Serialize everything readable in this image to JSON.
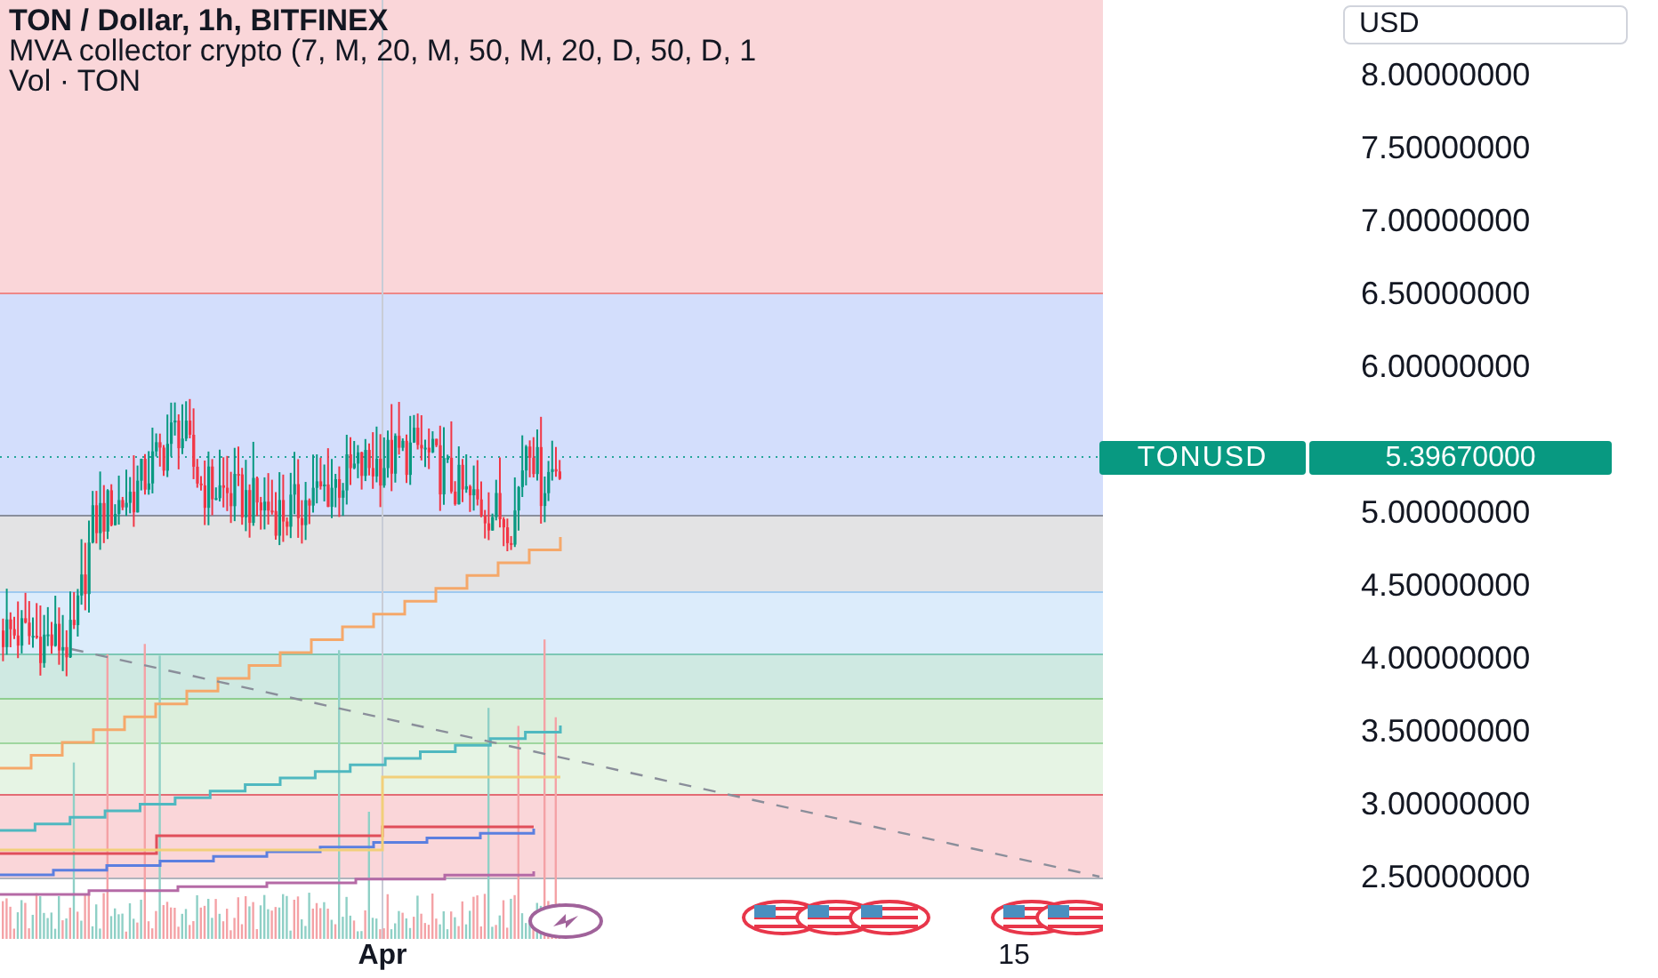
{
  "legend": {
    "title": "TON / Dollar, 1h, BITFINEX",
    "indicator": "MVA collector crypto (7, M, 20, M, 50, M, 20, D, 50, D, 1",
    "volume": "Vol · TON"
  },
  "zones": [
    {
      "color": "#fad6d9"
    },
    {
      "color": "#d3defc"
    },
    {
      "color": "#e3e3e4"
    },
    {
      "color": "#dcecfb"
    },
    {
      "color": "#cfe9e2"
    },
    {
      "color": "#dcefdc"
    },
    {
      "color": "#e6f4e4"
    },
    {
      "color": "#fad6d9"
    }
  ],
  "price_axis": {
    "currency": "USD",
    "labels": [
      "8.00000000",
      "7.50000000",
      "7.00000000",
      "6.50000000",
      "6.00000000",
      "5.00000000",
      "4.50000000",
      "4.00000000",
      "3.50000000",
      "3.00000000",
      "2.50000000"
    ]
  },
  "price_tag": {
    "symbol": "TONUSD",
    "price": "5.39670000"
  },
  "time_axis": {
    "labels": [
      {
        "text": "Apr",
        "kind": "month"
      },
      {
        "text": "15",
        "kind": "day"
      }
    ]
  }
}
